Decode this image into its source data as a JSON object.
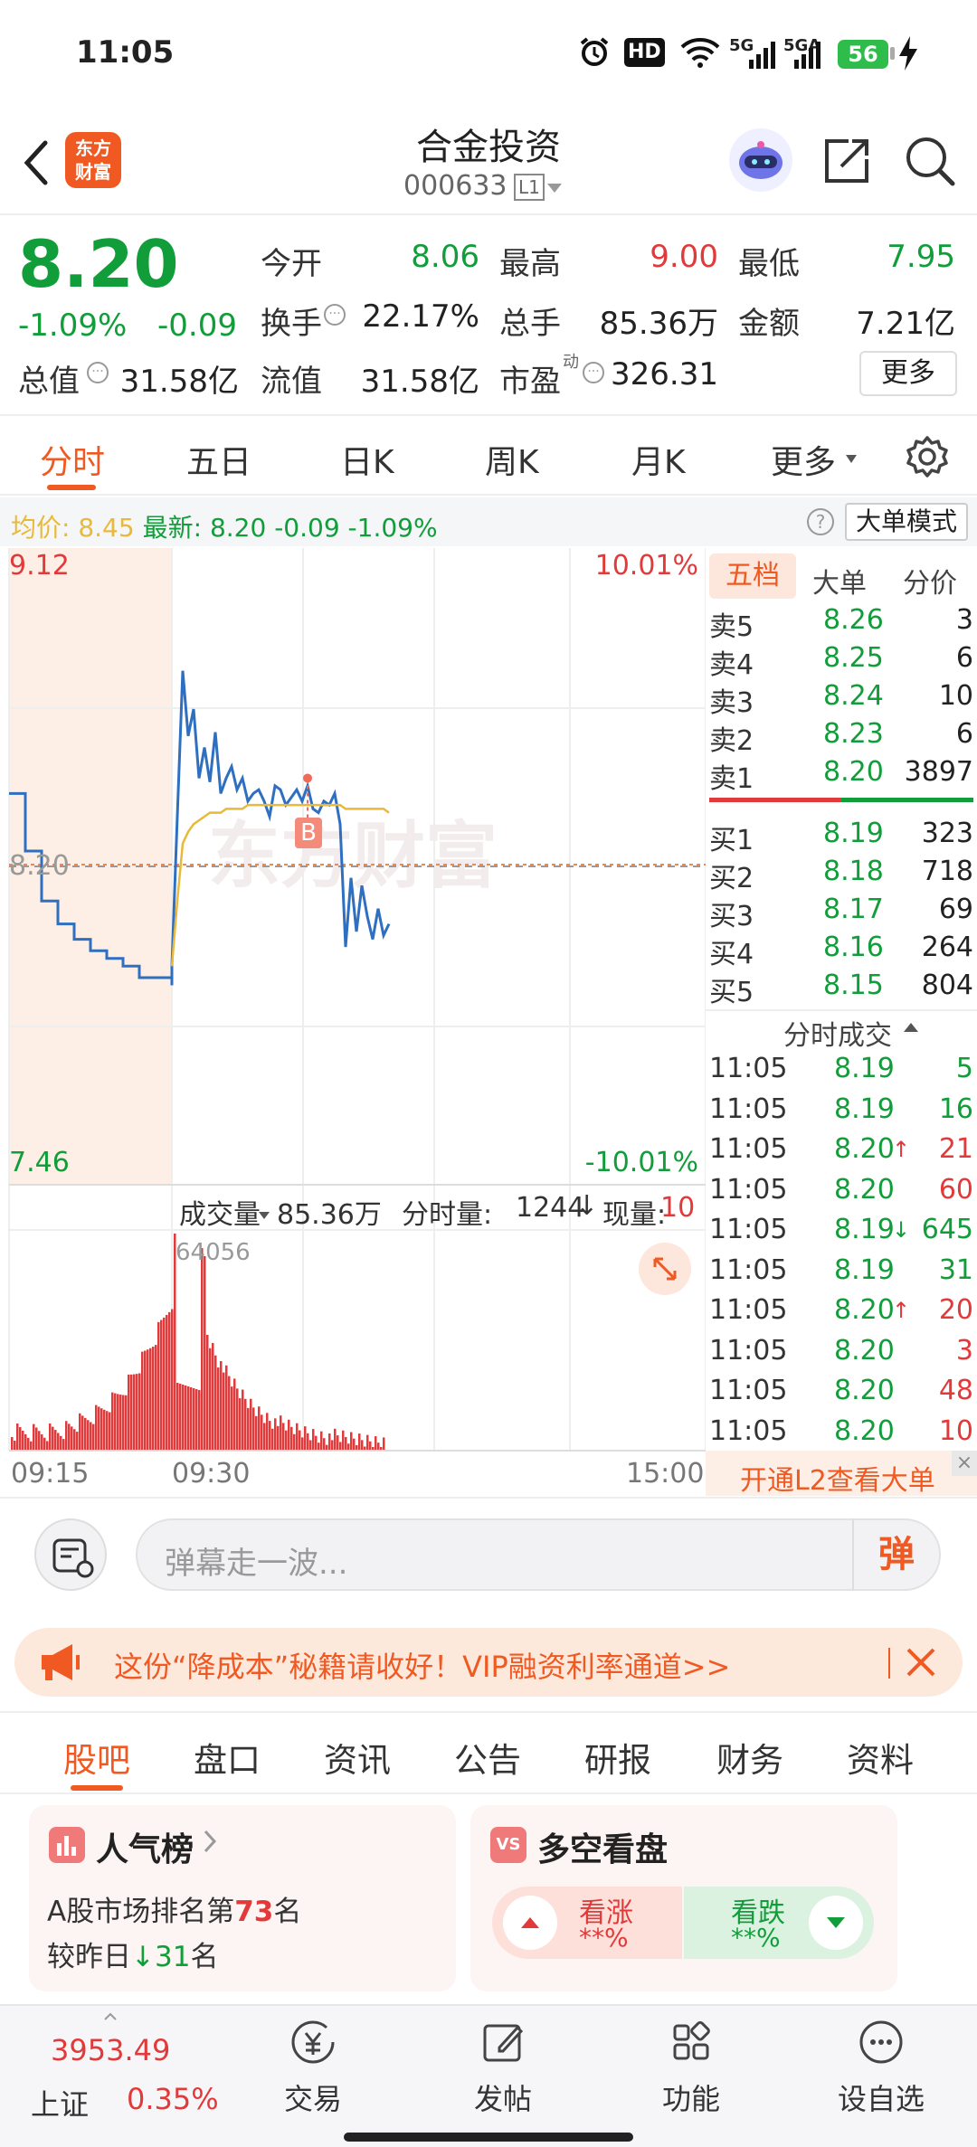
{
  "status_bar": {
    "time": "11:05",
    "battery": "56",
    "network1": "5G",
    "network2": "5GA",
    "hd": "HD"
  },
  "header": {
    "stock_name": "合金投资",
    "stock_code": "000633",
    "level": "L1",
    "logo_text": "东方财富"
  },
  "quote": {
    "price": "8.20",
    "change_pct": "-1.09%",
    "change": "-0.09",
    "open_label": "今开",
    "open": "8.06",
    "high_label": "最高",
    "high": "9.00",
    "low_label": "最低",
    "low": "7.95",
    "turnover_label": "换手",
    "turnover": "22.17%",
    "volume_label": "总手",
    "volume": "85.36万",
    "amount_label": "金额",
    "amount": "7.21亿",
    "mktcap_label": "总值",
    "mktcap": "31.58亿",
    "float_label": "流值",
    "float": "31.58亿",
    "pe_label": "市盈",
    "pe_sup": "动",
    "pe": "326.31",
    "more_button": "更多"
  },
  "k_tabs": [
    "分时",
    "五日",
    "日K",
    "周K",
    "月K",
    "更多"
  ],
  "info_row": {
    "avg_label": "均价:",
    "avg": "8.45",
    "latest_label": "最新:",
    "latest": "8.20",
    "chg": "-0.09",
    "chg_pct": "-1.09%",
    "mode_button": "大单模式",
    "help": "?"
  },
  "chart": {
    "y_max": "9.12",
    "y_min": "7.46",
    "pct_max": "10.01%",
    "pct_min": "-10.01%",
    "mid_label": "8.20",
    "marker": "B",
    "watermark": "东方财富",
    "vol_label": "成交量",
    "vol_total": "85.36万",
    "period_vol_label": "分时量:",
    "period_vol": "1244",
    "cur_vol_label": "现量:",
    "cur_vol": "10",
    "vol_max": "64056",
    "x_labels": [
      "09:15",
      "09:30",
      "15:00"
    ]
  },
  "chart_data": {
    "type": "line",
    "title": "",
    "ylim": [
      7.46,
      9.12
    ],
    "x": [
      "09:15",
      "09:16",
      "09:17",
      "09:18",
      "09:19",
      "09:20",
      "09:21",
      "09:22",
      "09:23",
      "09:24",
      "09:25",
      "09:30",
      "09:31",
      "09:32",
      "09:33",
      "09:34",
      "09:35",
      "09:36",
      "09:37",
      "09:38",
      "09:39",
      "09:40",
      "09:41",
      "09:42",
      "09:43",
      "09:44",
      "09:45",
      "09:46",
      "09:47",
      "09:48",
      "09:49",
      "09:50",
      "09:51",
      "09:52",
      "09:53",
      "09:54",
      "09:55",
      "09:56",
      "09:57",
      "09:58",
      "09:59",
      "10:00",
      "10:01",
      "10:02",
      "10:03",
      "10:04",
      "10:05",
      "10:06",
      "10:07",
      "10:08",
      "10:09",
      "10:10"
    ],
    "series": [
      {
        "values": [
          8.48,
          8.33,
          8.2,
          8.14,
          8.1,
          8.07,
          8.05,
          8.03,
          8.0,
          8.0,
          7.98,
          8.03,
          8.42,
          8.8,
          8.63,
          8.7,
          8.52,
          8.6,
          8.51,
          8.64,
          8.48,
          8.52,
          8.55,
          8.49,
          8.52,
          8.46,
          8.48,
          8.49,
          8.46,
          8.42,
          8.5,
          8.49,
          8.45,
          8.47,
          8.49,
          8.46,
          8.5,
          8.44,
          8.43,
          8.46,
          8.45,
          8.48,
          8.4,
          8.08,
          8.26,
          8.12,
          8.24,
          8.16,
          8.1,
          8.18,
          8.11,
          8.14
        ]
      },
      {
        "values": [
          null,
          null,
          null,
          null,
          null,
          null,
          null,
          null,
          null,
          null,
          null,
          8.03,
          8.2,
          8.35,
          8.38,
          8.4,
          8.41,
          8.42,
          8.43,
          8.43,
          8.43,
          8.44,
          8.44,
          8.44,
          8.44,
          8.45,
          8.45,
          8.45,
          8.45,
          8.45,
          8.45,
          8.45,
          8.45,
          8.45,
          8.45,
          8.45,
          8.45,
          8.45,
          8.45,
          8.45,
          8.45,
          8.45,
          8.45,
          8.44,
          8.44,
          8.44,
          8.44,
          8.44,
          8.44,
          8.44,
          8.44,
          8.43
        ]
      }
    ]
  },
  "book_tabs": [
    "五档",
    "大单",
    "分价"
  ],
  "sells": [
    {
      "label": "卖5",
      "price": "8.26",
      "vol": "3"
    },
    {
      "label": "卖4",
      "price": "8.25",
      "vol": "6"
    },
    {
      "label": "卖3",
      "price": "8.24",
      "vol": "10"
    },
    {
      "label": "卖2",
      "price": "8.23",
      "vol": "6"
    },
    {
      "label": "卖1",
      "price": "8.20",
      "vol": "3897"
    }
  ],
  "buys": [
    {
      "label": "买1",
      "price": "8.19",
      "vol": "323"
    },
    {
      "label": "买2",
      "price": "8.18",
      "vol": "718"
    },
    {
      "label": "买3",
      "price": "8.17",
      "vol": "69"
    },
    {
      "label": "买4",
      "price": "8.16",
      "vol": "264"
    },
    {
      "label": "买5",
      "price": "8.15",
      "vol": "804"
    }
  ],
  "ticks_header": "分时成交",
  "ticks": [
    {
      "time": "11:05",
      "price": "8.19",
      "arrow": "",
      "vol": "5",
      "vcolor": "green"
    },
    {
      "time": "11:05",
      "price": "8.19",
      "arrow": "",
      "vol": "16",
      "vcolor": "green"
    },
    {
      "time": "11:05",
      "price": "8.20",
      "arrow": "↑",
      "vol": "21",
      "vcolor": "red"
    },
    {
      "time": "11:05",
      "price": "8.20",
      "arrow": "",
      "vol": "60",
      "vcolor": "red"
    },
    {
      "time": "11:05",
      "price": "8.19",
      "arrow": "↓",
      "vol": "645",
      "vcolor": "green"
    },
    {
      "time": "11:05",
      "price": "8.19",
      "arrow": "",
      "vol": "31",
      "vcolor": "green"
    },
    {
      "time": "11:05",
      "price": "8.20",
      "arrow": "↑",
      "vol": "20",
      "vcolor": "red"
    },
    {
      "time": "11:05",
      "price": "8.20",
      "arrow": "",
      "vol": "3",
      "vcolor": "red"
    },
    {
      "time": "11:05",
      "price": "8.20",
      "arrow": "",
      "vol": "48",
      "vcolor": "red"
    },
    {
      "time": "11:05",
      "price": "8.20",
      "arrow": "",
      "vol": "10",
      "vcolor": "red"
    }
  ],
  "l2_banner": "开通L2查看大单",
  "comment": {
    "placeholder": "弹幕走一波...",
    "danmu": "弹"
  },
  "promo": {
    "text": "这份“降成本”秘籍请收好！VIP融资利率通道>>"
  },
  "bottom_tabs": [
    "股吧",
    "盘口",
    "资讯",
    "公告",
    "研报",
    "财务",
    "资料"
  ],
  "popularity": {
    "title": "人气榜",
    "line1_prefix": "A股市场排名第",
    "rank": "73",
    "line1_suffix": "名",
    "line2_prefix": "较昨日",
    "change": "31",
    "line2_suffix": "名"
  },
  "sentiment": {
    "title": "多空看盘",
    "bull_label": "看涨",
    "bull_val": "**%",
    "bear_label": "看跌",
    "bear_val": "**%"
  },
  "nav": {
    "index_value": "3953.49",
    "index_name": "上证",
    "index_pct": "0.35%",
    "items": [
      "交易",
      "发帖",
      "功能",
      "设自选"
    ]
  },
  "colors": {
    "red": "#e23a3a",
    "green": "#119e3a",
    "blue": "#2f6fbf",
    "avg": "#e8b93a",
    "brand": "#f05a22"
  }
}
